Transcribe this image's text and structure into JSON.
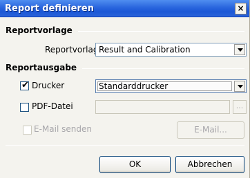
{
  "window": {
    "title": "Report definieren",
    "close_label": "×"
  },
  "group_template": {
    "title": "Reportvorlage",
    "field_label": "Reportvorlage",
    "field_value": "Result and Calibration"
  },
  "group_output": {
    "title": "Reportausgabe",
    "printer": {
      "label": "Drucker",
      "checked": true,
      "value": "Standarddrucker"
    },
    "pdf": {
      "label": "PDF-Datei",
      "checked": false,
      "value": "",
      "browse_label": "..."
    },
    "email": {
      "label": "E-Mail senden",
      "checked": false,
      "button_label": "E-Mail..."
    }
  },
  "buttons": {
    "ok": "OK",
    "cancel": "Abbrechen"
  },
  "icons": {
    "close": "close-icon",
    "dropdown": "chevron-down-icon",
    "check": "checkmark-icon"
  }
}
